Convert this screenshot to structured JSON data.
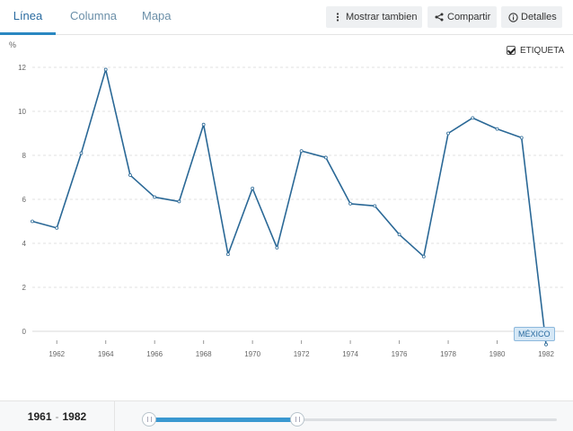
{
  "tabs": [
    {
      "label": "Línea",
      "active": true
    },
    {
      "label": "Columna",
      "active": false
    },
    {
      "label": "Mapa",
      "active": false
    }
  ],
  "toolbar": {
    "mostrar_label": "Mostrar tambien",
    "compartir_label": "Compartir",
    "detalles_label": "Detalles"
  },
  "chart_controls": {
    "unit": "%",
    "etiqueta_label": "ETIQUETA",
    "etiqueta_checked": true,
    "series_tag": "MÉXICO"
  },
  "range": {
    "start": "1961",
    "separator": "-",
    "end": "1982",
    "slider_handles": [
      0.0,
      0.37
    ]
  },
  "colors": {
    "line": "#2a6896",
    "accent": "#2a87c1",
    "slider_fill": "#3a98d0"
  },
  "chart_data": {
    "type": "line",
    "title": "",
    "xlabel": "",
    "ylabel": "%",
    "xlim": [
      1961,
      1982
    ],
    "ylim": [
      0,
      12
    ],
    "yticks": [
      0,
      2,
      4,
      6,
      8,
      10,
      12
    ],
    "xticks": [
      1962,
      1964,
      1966,
      1968,
      1970,
      1972,
      1974,
      1976,
      1978,
      1980,
      1982
    ],
    "grid": true,
    "series": [
      {
        "name": "MÉXICO",
        "x": [
          1961,
          1962,
          1963,
          1964,
          1965,
          1966,
          1967,
          1968,
          1969,
          1970,
          1971,
          1972,
          1973,
          1974,
          1975,
          1976,
          1977,
          1978,
          1979,
          1980,
          1981,
          1982
        ],
        "y": [
          5.0,
          4.7,
          8.1,
          11.9,
          7.1,
          6.1,
          5.9,
          9.4,
          3.5,
          6.5,
          3.8,
          8.2,
          7.9,
          5.8,
          5.7,
          4.4,
          3.4,
          9.0,
          9.7,
          9.2,
          8.8,
          -0.6
        ]
      }
    ]
  }
}
